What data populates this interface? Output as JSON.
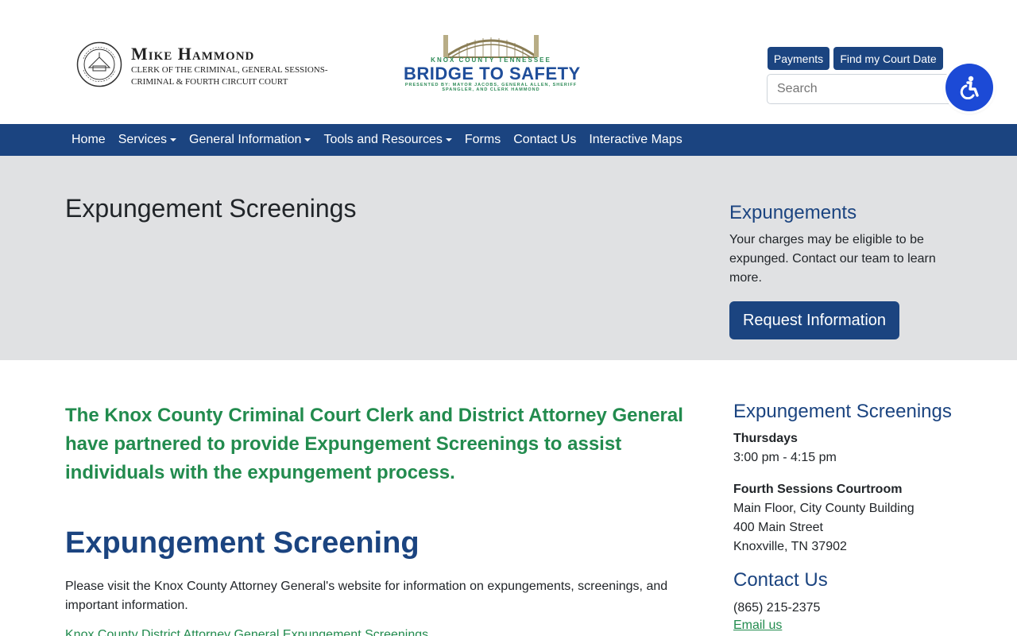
{
  "header": {
    "clerk_name": "Mike Hammond",
    "clerk_title_line1": "CLERK OF THE CRIMINAL, GENERAL SESSIONS-",
    "clerk_title_line2": "CRIMINAL & FOURTH CIRCUIT COURT",
    "seal_text": "OFFICIAL SEAL KNOX COUNTY, TENN.",
    "bridge": {
      "county": "KNOX COUNTY TENNESSEE",
      "title": "BRIDGE TO SAFETY",
      "presented": "PRESENTED BY: MAYOR JACOBS, GENERAL ALLEN, SHERIFF SPANGLER, AND CLERK HAMMOND"
    },
    "payments_label": "Payments",
    "court_date_label": "Find my Court Date",
    "search_placeholder": "Search",
    "accessibility_icon": "accessibility-icon"
  },
  "nav": {
    "items": [
      {
        "label": "Home",
        "dropdown": false
      },
      {
        "label": "Services",
        "dropdown": true
      },
      {
        "label": "General Information",
        "dropdown": true
      },
      {
        "label": "Tools and Resources",
        "dropdown": true
      },
      {
        "label": "Forms",
        "dropdown": false
      },
      {
        "label": "Contact Us",
        "dropdown": false
      },
      {
        "label": "Interactive Maps",
        "dropdown": false
      }
    ]
  },
  "hero": {
    "title": "Expungement Screenings",
    "side_title": "Expungements",
    "side_text": "Your charges may be eligible to be expunged. Contact our team to learn more.",
    "button_label": "Request Information"
  },
  "main": {
    "lead": "The Knox County Criminal Court Clerk and District Attorney General have partnered to provide Expungement Screenings to assist individuals with the expungement process.",
    "heading": "Expungement Screening",
    "paragraph": "Please visit the Knox County Attorney General's website for information on expungements, screenings, and important information.",
    "link": "Knox County District Attorney General Expungement Screenings"
  },
  "sidebar": {
    "screenings_title": "Expungement Screenings",
    "day": "Thursdays",
    "time": "3:00 pm - 4:15 pm",
    "location_name": "Fourth Sessions Courtroom",
    "address1": "Main Floor, City County Building",
    "address2": "400 Main Street",
    "address3": "Knoxville, TN 37902",
    "contact_title": "Contact Us",
    "phone": "(865) 215-2375",
    "email_label": "Email us"
  },
  "colors": {
    "navy": "#1b4480",
    "green": "#228b4e",
    "hero_bg": "#e0e1e3",
    "a11y_blue": "#1c4ad6"
  }
}
